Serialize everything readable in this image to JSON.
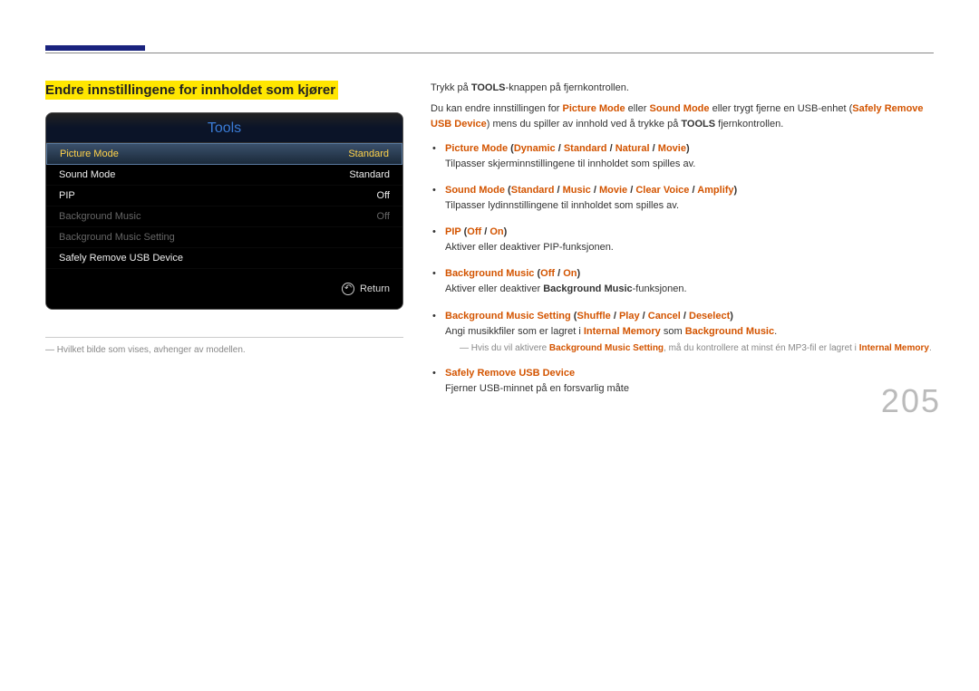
{
  "header": {
    "section_title": "Endre innstillingene for innholdet som kjører"
  },
  "tools_panel": {
    "title": "Tools",
    "rows": [
      {
        "label": "Picture Mode",
        "value": "Standard",
        "selected": true
      },
      {
        "label": "Sound Mode",
        "value": "Standard"
      },
      {
        "label": "PIP",
        "value": "Off"
      },
      {
        "label": "Background Music",
        "value": "Off",
        "muted": true
      },
      {
        "label": "Background Music Setting",
        "value": "",
        "muted": true
      },
      {
        "label": "Safely Remove USB Device",
        "value": ""
      }
    ],
    "footer_return": "Return"
  },
  "left_footnote": "Hvilket bilde som vises, avhenger av modellen.",
  "right": {
    "intro1_pre": "Trykk på ",
    "intro1_bold": "TOOLS",
    "intro1_post": "-knappen på fjernkontrollen.",
    "intro2_a": "Du kan endre innstillingen for ",
    "intro2_pm": "Picture Mode",
    "intro2_b": " eller ",
    "intro2_sm": "Sound Mode",
    "intro2_c": " eller trygt fjerne en USB-enhet (",
    "intro2_safe": "Safely Remove USB Device",
    "intro2_d": ") mens du spiller av innhold ved å trykke på ",
    "intro2_tools": "TOOLS",
    "intro2_e": " fjernkontrollen.",
    "items": {
      "picture": {
        "label": "Picture Mode",
        "opts": [
          "Dynamic",
          "Standard",
          "Natural",
          "Movie"
        ],
        "desc": "Tilpasser skjerminnstillingene til innholdet som spilles av."
      },
      "sound": {
        "label": "Sound Mode",
        "opts": [
          "Standard",
          "Music",
          "Movie",
          "Clear Voice",
          "Amplify"
        ],
        "desc": "Tilpasser lydinnstillingene til innholdet som spilles av."
      },
      "pip": {
        "label": "PIP",
        "opts": [
          "Off",
          "On"
        ],
        "desc": "Aktiver eller deaktiver PIP-funksjonen."
      },
      "bgm": {
        "label": "Background Music",
        "opts": [
          "Off",
          "On"
        ],
        "desc_a": "Aktiver eller deaktiver ",
        "desc_bold": "Background Music",
        "desc_b": "-funksjonen."
      },
      "bgms": {
        "label": "Background Music Setting",
        "opts": [
          "Shuffle",
          "Play",
          "Cancel",
          "Deselect"
        ],
        "desc_a": "Angi musikkfiler som er lagret i ",
        "desc_im": "Internal Memory",
        "desc_b": " som ",
        "desc_bgm": "Background Music",
        "desc_c": ".",
        "note_a": "Hvis du vil aktivere ",
        "note_bgms": "Background Music Setting",
        "note_b": ", må du kontrollere at minst én MP3-fil er lagret i ",
        "note_im": "Internal Memory",
        "note_c": "."
      },
      "safe": {
        "label": "Safely Remove USB Device",
        "desc": "Fjerner USB-minnet på en forsvarlig måte"
      }
    }
  },
  "page_number": "205",
  "sep": " / ",
  "paren_open": " (",
  "paren_close": ")"
}
